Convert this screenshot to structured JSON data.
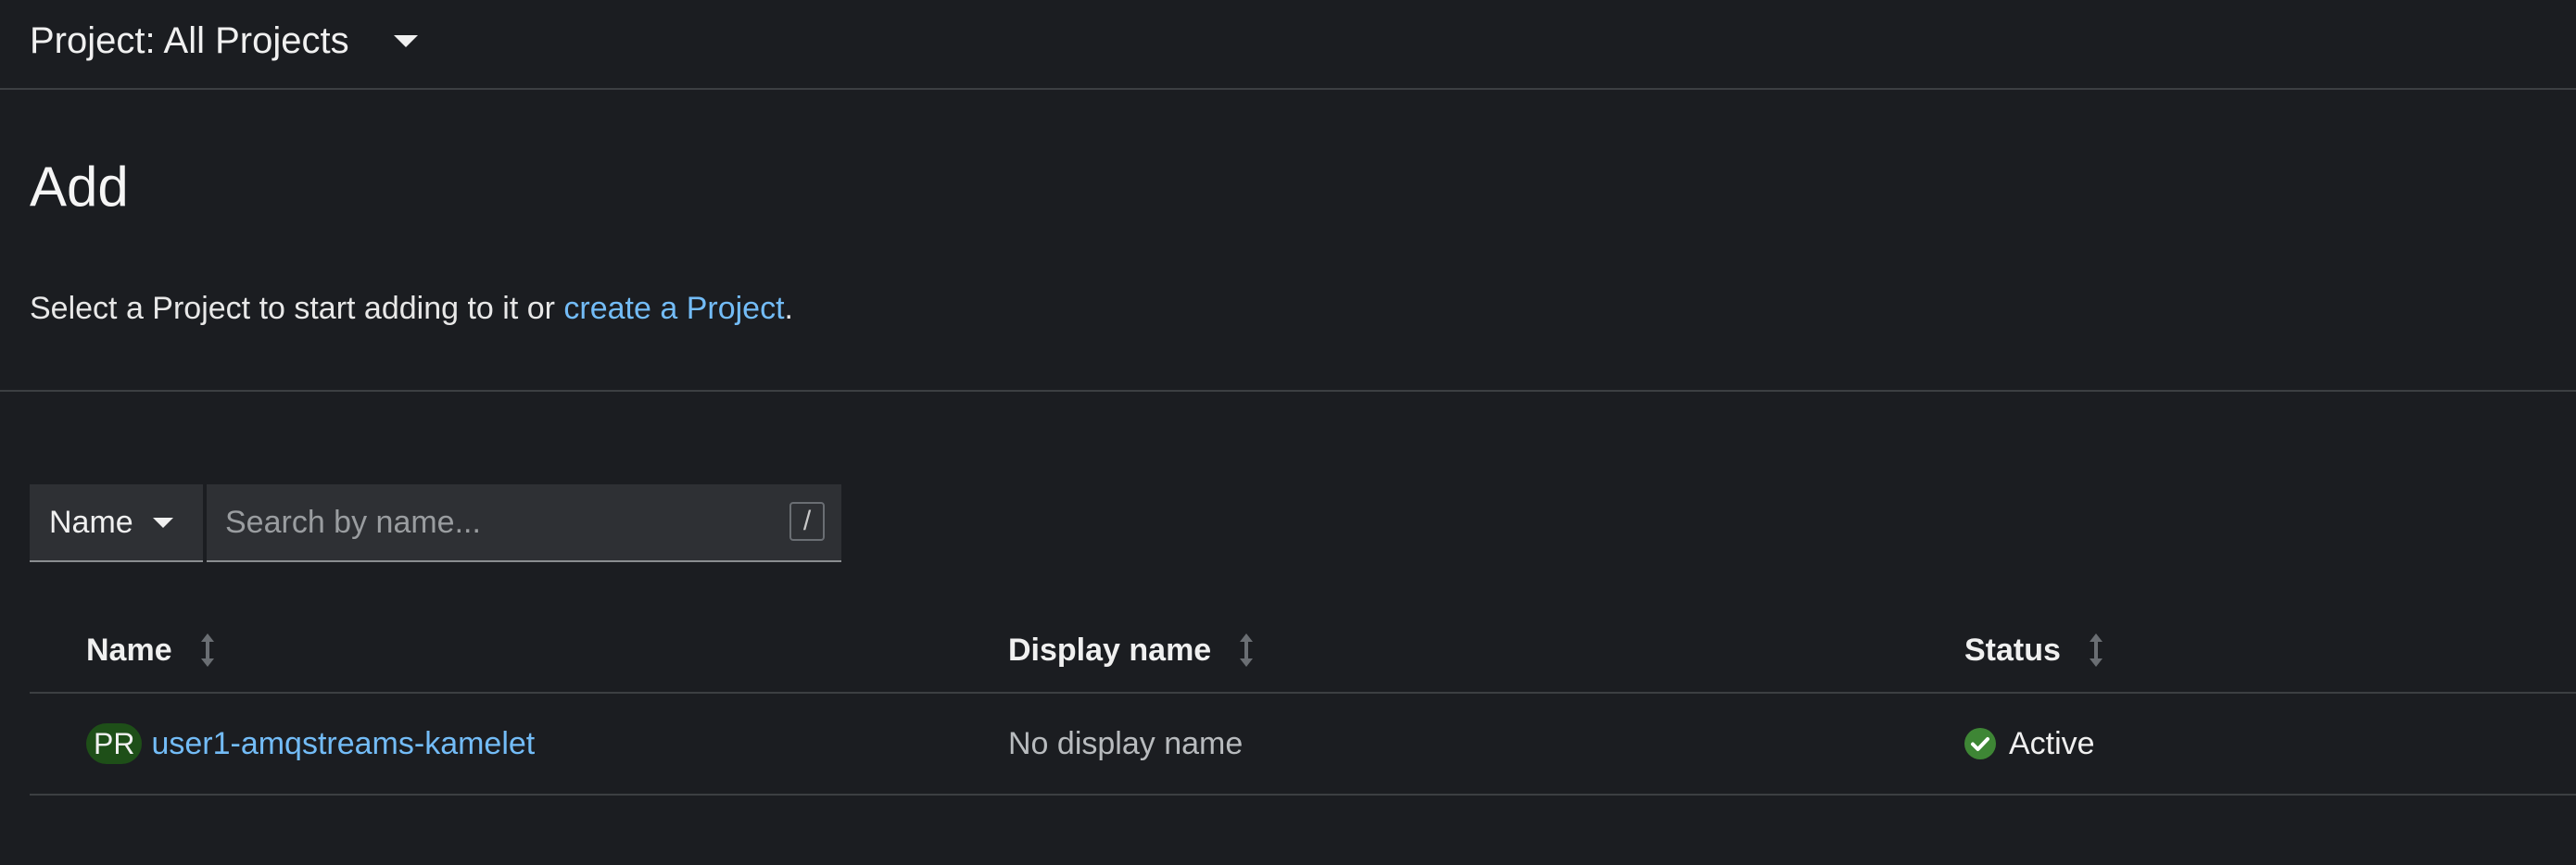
{
  "project_selector": {
    "label": "Project: All Projects"
  },
  "page": {
    "title": "Add",
    "description_prefix": "Select a Project to start adding to it or ",
    "description_link": "create a Project",
    "description_suffix": "."
  },
  "filter": {
    "selected": "Name",
    "search_placeholder": "Search by name...",
    "search_value": "",
    "shortcut_hint": "/"
  },
  "table": {
    "columns": [
      "Name",
      "Display name",
      "Status"
    ],
    "rows": [
      {
        "badge": "PR",
        "name": "user1-amqstreams-kamelet",
        "display_name": "No display name",
        "status": "Active"
      }
    ]
  },
  "colors": {
    "background": "#1b1d21",
    "link": "#73bcf7",
    "badge_bg": "#1e4f18",
    "status_ok": "#3e8635"
  }
}
